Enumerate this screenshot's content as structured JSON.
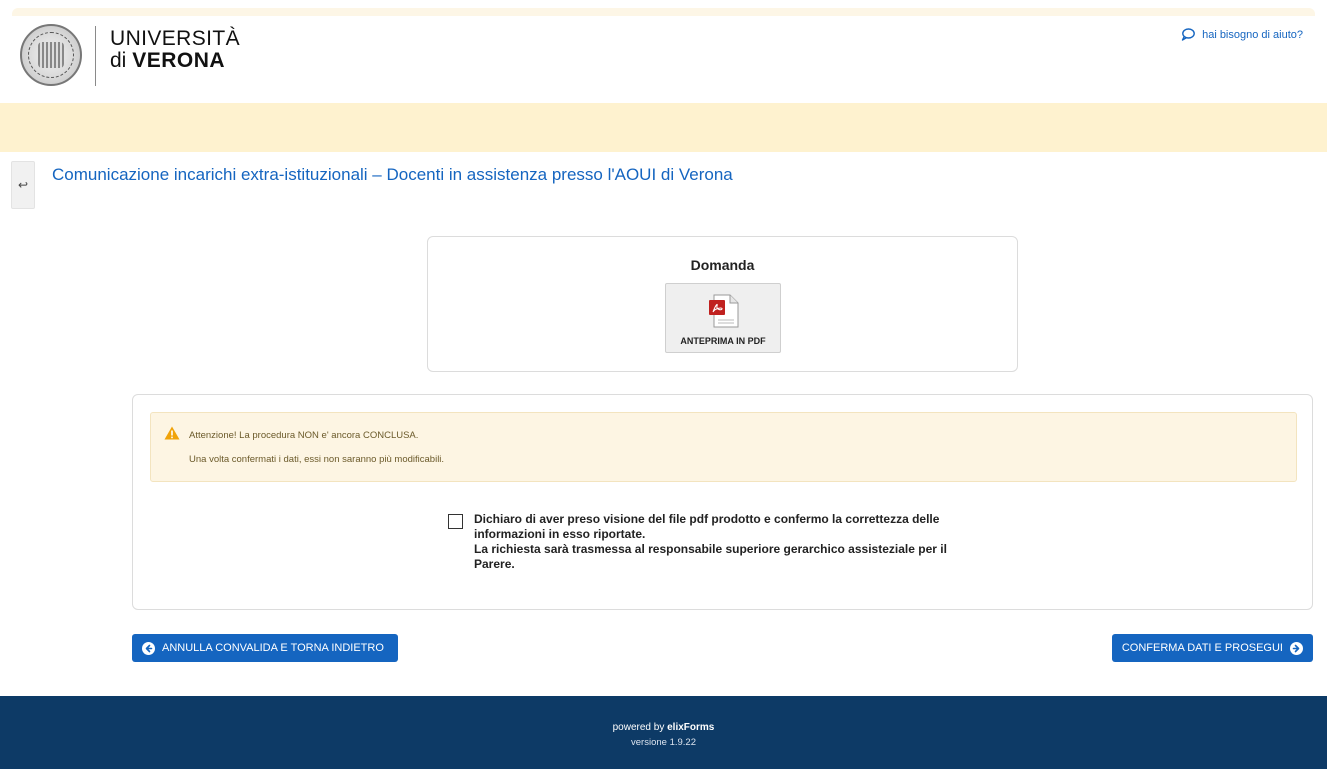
{
  "header": {
    "logo_line1": "UNIVERSITÀ",
    "logo_line2_prefix": "di",
    "logo_line2_bold": "VERONA",
    "help_link": "hai bisogno di aiuto?",
    "help_icon": "speech-bubble-icon"
  },
  "page": {
    "back_icon": "arrow-left-icon",
    "title": "Comunicazione incarichi extra-istituzionali – Docenti in assistenza presso l'AOUI di Verona"
  },
  "document": {
    "title": "Domanda",
    "preview_label": "ANTEPRIMA IN PDF",
    "preview_icon": "pdf-file-icon"
  },
  "warning": {
    "icon": "warning-triangle-icon",
    "line1": "Attenzione! La procedura NON e' ancora CONCLUSA.",
    "line2": "Una volta confermati i dati, essi non saranno più modificabili."
  },
  "consent": {
    "checked": false,
    "line1": "Dichiaro di aver preso visione del file pdf prodotto e confermo la correttezza delle informazioni in esso riportate.",
    "line2": "La richiesta sarà trasmessa al responsabile superiore gerarchico assisteziale per il Parere."
  },
  "actions": {
    "cancel_label": "ANNULLA CONVALIDA E TORNA INDIETRO",
    "cancel_icon": "circle-arrow-left-icon",
    "confirm_label": "CONFERMA DATI E PROSEGUI",
    "confirm_icon": "circle-arrow-right-icon"
  },
  "footer": {
    "powered_prefix": "powered by",
    "powered_brand": "elixForms",
    "version": "versione 1.9.22"
  },
  "colors": {
    "primary": "#1565c0",
    "band": "#fef2cf",
    "warning_bg": "#fdf5e3",
    "footer": "#0d3a66"
  }
}
